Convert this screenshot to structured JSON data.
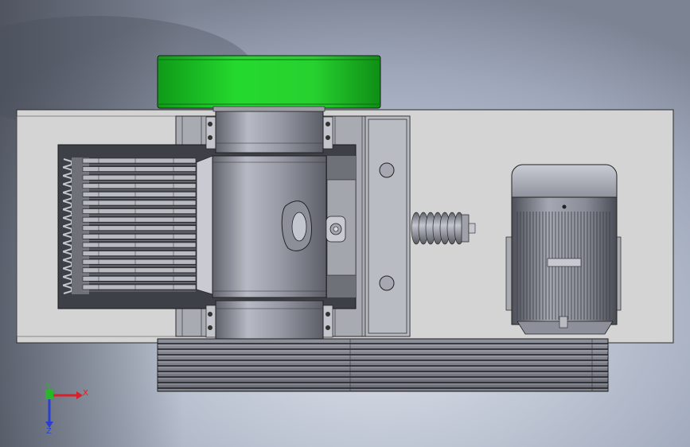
{
  "scene": {
    "background_top": "#a9b3c6",
    "background_mid": "#c6cdda",
    "background_dark": "#6d7381",
    "base_plate": "#d3d3d3",
    "steel": "#8e919c",
    "steel_dark": "#55575f",
    "steel_light": "#bfc2cc",
    "flywheel_green": "#22d42c",
    "edge": "#2a2a2a"
  },
  "triad": {
    "x_label": "X",
    "y_label": "Y",
    "z_label": "Z",
    "x_color": "#d6202a",
    "y_color": "#29b62b",
    "z_color": "#2a3fd0"
  }
}
